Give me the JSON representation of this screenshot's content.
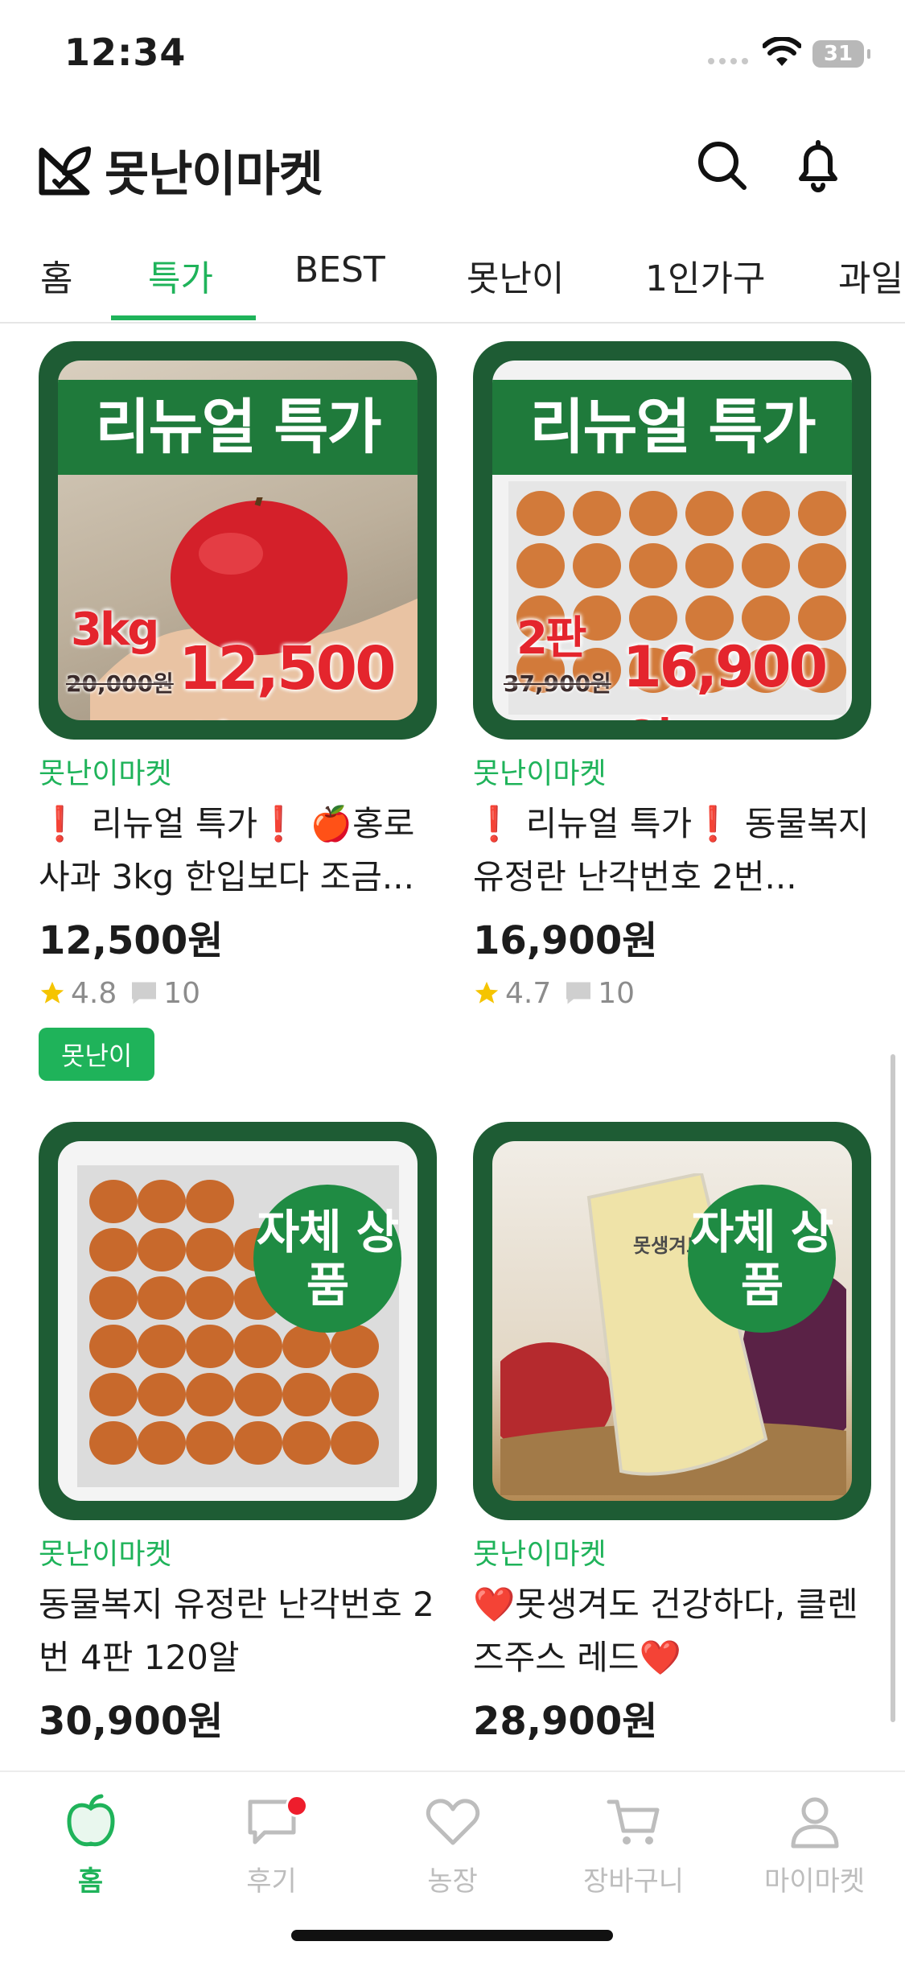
{
  "status_bar": {
    "time": "12:34",
    "battery": "31"
  },
  "header": {
    "brand": "못난이마켓"
  },
  "tabs": [
    {
      "label": "홈"
    },
    {
      "label": "특가"
    },
    {
      "label": "BEST"
    },
    {
      "label": "못난이"
    },
    {
      "label": "1인가구"
    },
    {
      "label": "과일"
    }
  ],
  "active_tab": "특가",
  "products": [
    {
      "banner": "리뉴얼 특가",
      "image_qty": "3kg",
      "image_price": "12,500원",
      "image_old_price": "20,000원",
      "seller": "못난이마켓",
      "title": "❗ 리뉴얼 특가❗ 🍎홍로 사과 3kg 한입보다 조금...",
      "price": "12,500원",
      "rating": "4.8",
      "reviews": "10",
      "badge": "못난이"
    },
    {
      "banner": "리뉴얼 특가",
      "image_qty": "2판",
      "image_price": "16,900원",
      "image_old_price": "37,900원",
      "seller": "못난이마켓",
      "title": "❗ 리뉴얼 특가❗ 동물복지 유정란 난각번호 2번...",
      "price": "16,900원",
      "rating": "4.7",
      "reviews": "10"
    },
    {
      "seal": "자체 상품",
      "seller": "못난이마켓",
      "title": "동물복지 유정란 난각번호 2번 4판 120알",
      "price": "30,900원"
    },
    {
      "seal": "자체 상품",
      "pouch_text": "못생겨도",
      "seller": "못난이마켓",
      "title": "❤️못생겨도 건강하다, 클렌즈주스 레드❤️",
      "price": "28,900원"
    }
  ],
  "bottom_nav": [
    {
      "label": "홈",
      "icon": "apple-icon"
    },
    {
      "label": "후기",
      "icon": "chat-icon"
    },
    {
      "label": "농장",
      "icon": "heart-icon"
    },
    {
      "label": "장바구니",
      "icon": "cart-icon"
    },
    {
      "label": "마이마켓",
      "icon": "person-icon"
    }
  ],
  "colors": {
    "accent": "#1fb35a",
    "card_frame": "#1e5c34",
    "banner": "#1f7a3b",
    "sale_red": "#e4252d",
    "notification": "#ee1d2c"
  }
}
